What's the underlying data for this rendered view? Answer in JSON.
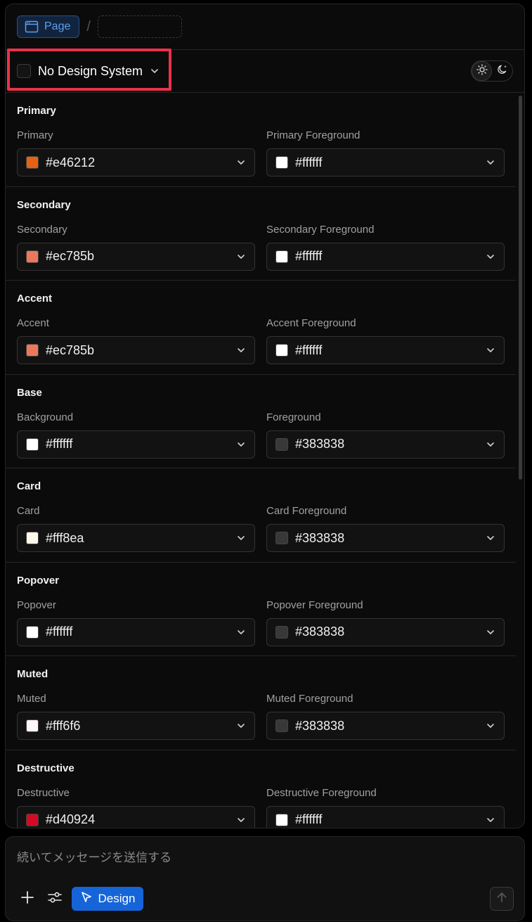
{
  "breadcrumb": {
    "page_label": "Page"
  },
  "design_system": {
    "label": "No Design System"
  },
  "sections": [
    {
      "title": "Primary",
      "fields": [
        {
          "label": "Primary",
          "value": "#e46212",
          "swatch": "#e46212"
        },
        {
          "label": "Primary Foreground",
          "value": "#ffffff",
          "swatch": "#ffffff"
        }
      ]
    },
    {
      "title": "Secondary",
      "fields": [
        {
          "label": "Secondary",
          "value": "#ec785b",
          "swatch": "#ec785b"
        },
        {
          "label": "Secondary Foreground",
          "value": "#ffffff",
          "swatch": "#ffffff"
        }
      ]
    },
    {
      "title": "Accent",
      "fields": [
        {
          "label": "Accent",
          "value": "#ec785b",
          "swatch": "#ec785b"
        },
        {
          "label": "Accent Foreground",
          "value": "#ffffff",
          "swatch": "#ffffff"
        }
      ]
    },
    {
      "title": "Base",
      "fields": [
        {
          "label": "Background",
          "value": "#ffffff",
          "swatch": "#ffffff"
        },
        {
          "label": "Foreground",
          "value": "#383838",
          "swatch": "#383838"
        }
      ]
    },
    {
      "title": "Card",
      "fields": [
        {
          "label": "Card",
          "value": "#fff8ea",
          "swatch": "#fff8ea"
        },
        {
          "label": "Card Foreground",
          "value": "#383838",
          "swatch": "#383838"
        }
      ]
    },
    {
      "title": "Popover",
      "fields": [
        {
          "label": "Popover",
          "value": "#ffffff",
          "swatch": "#ffffff"
        },
        {
          "label": "Popover Foreground",
          "value": "#383838",
          "swatch": "#383838"
        }
      ]
    },
    {
      "title": "Muted",
      "fields": [
        {
          "label": "Muted",
          "value": "#fff6f6",
          "swatch": "#fff6f6"
        },
        {
          "label": "Muted Foreground",
          "value": "#383838",
          "swatch": "#383838"
        }
      ]
    },
    {
      "title": "Destructive",
      "fields": [
        {
          "label": "Destructive",
          "value": "#d40924",
          "swatch": "#d40924"
        },
        {
          "label": "Destructive Foreground",
          "value": "#ffffff",
          "swatch": "#ffffff"
        }
      ]
    }
  ],
  "composer": {
    "placeholder": "続いてメッセージを送信する",
    "design_label": "Design"
  },
  "colors": {
    "accent": "#1565d8",
    "highlight": "#e8334a"
  }
}
